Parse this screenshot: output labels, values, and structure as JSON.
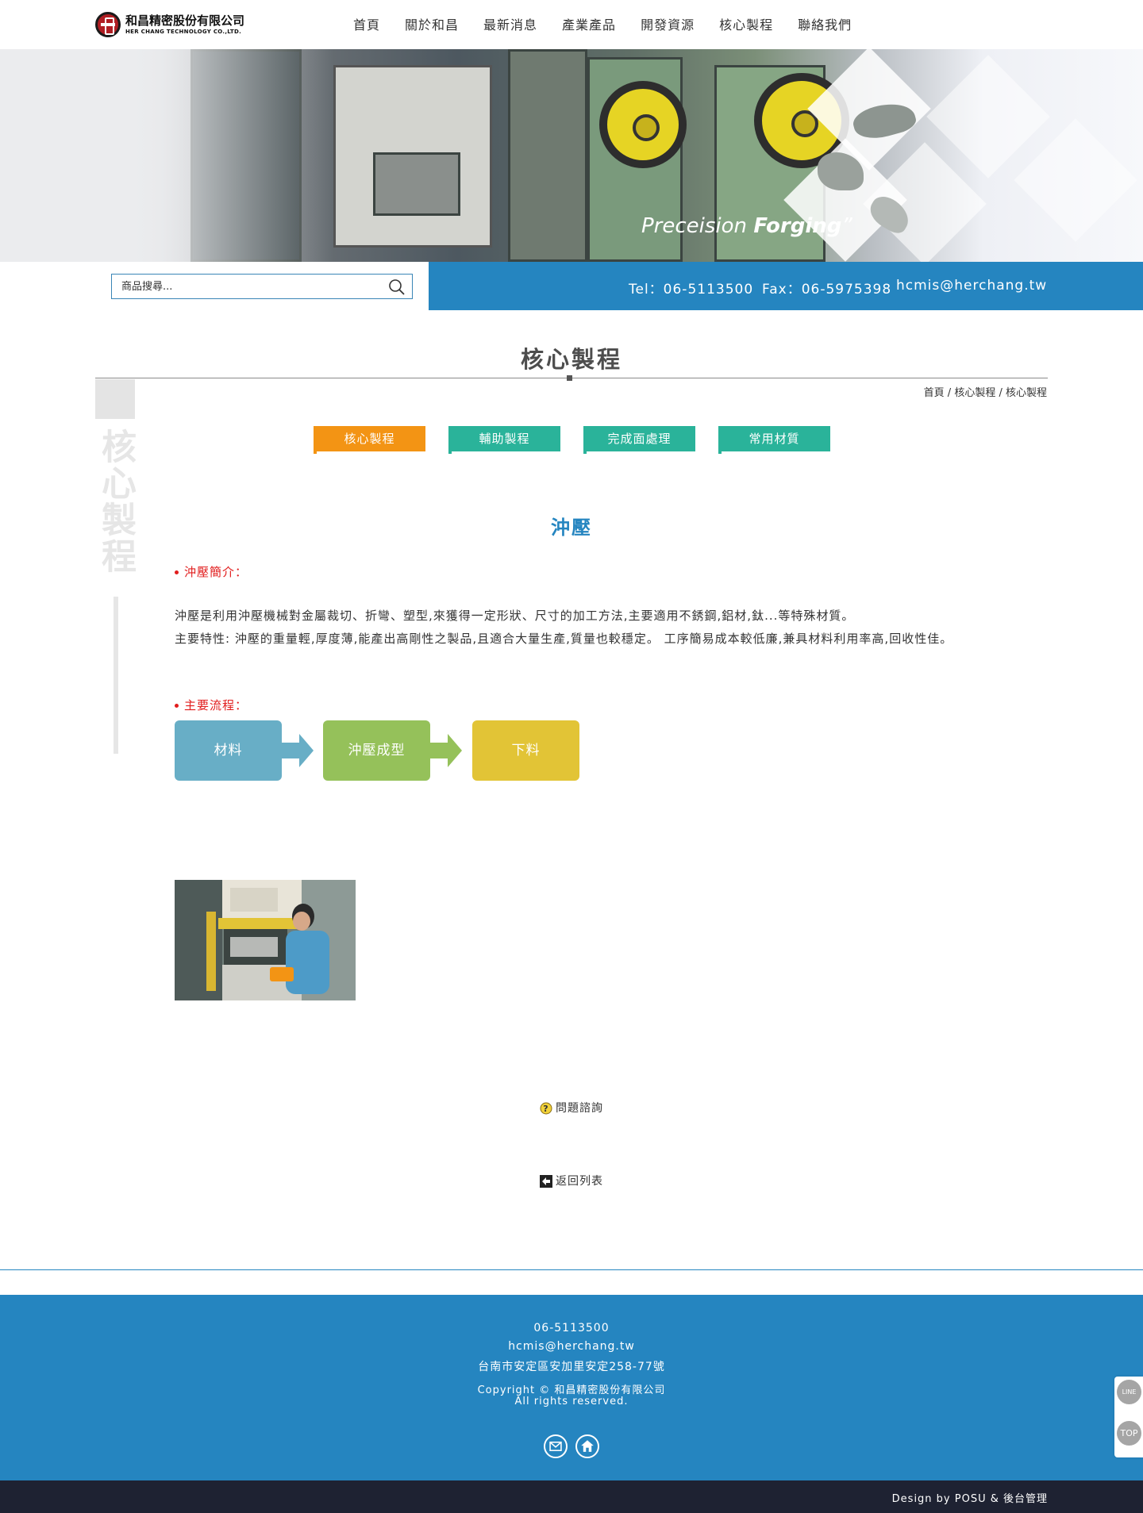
{
  "brand": {
    "name_cn": "和昌精密股份有限公司",
    "name_en": "HER CHANG TECHNOLOGY CO.,LTD."
  },
  "nav": {
    "items": [
      {
        "label": "首頁"
      },
      {
        "label": "關於和昌"
      },
      {
        "label": "最新消息"
      },
      {
        "label": "產業產品"
      },
      {
        "label": "開發資源"
      },
      {
        "label": "核心製程"
      },
      {
        "label": "聯絡我們"
      }
    ]
  },
  "banner": {
    "slogan_light": "Preceision ",
    "slogan_bold": "Forging",
    "slogan_mark": "”"
  },
  "search": {
    "placeholder": "商品搜尋..."
  },
  "contact": {
    "tel": "Tel：06-5113500",
    "fax": "Fax：06-5975398",
    "email": "hcmis@herchang.tw"
  },
  "page": {
    "title": "核心製程",
    "side_text": "核心製程"
  },
  "breadcrumb": {
    "home": "首頁",
    "sep": " / ",
    "level1": "核心製程",
    "level2": "核心製程"
  },
  "tabs": [
    {
      "label": "核心製程",
      "active": true
    },
    {
      "label": "輔助製程",
      "active": false
    },
    {
      "label": "完成面處理",
      "active": false
    },
    {
      "label": "常用材質",
      "active": false
    }
  ],
  "content": {
    "section_title": "沖壓",
    "intro_label": "沖壓簡介：",
    "intro_p1": "沖壓是利用沖壓機械對金屬裁切、折彎、塑型,來獲得一定形狀、尺寸的加工方法,主要適用不銹鋼,鋁材,鈦...等特殊材質。",
    "intro_p2": "主要特性: 沖壓的重量輕,厚度薄,能產出高剛性之製品,且適合大量生產,質量也較穩定。 工序簡易成本較低廉,兼具材料利用率高,回收性佳。",
    "flow_label": "主要流程：",
    "flow": [
      {
        "label": "材料",
        "color": "#68aec6"
      },
      {
        "label": "沖壓成型",
        "color": "#95c15a"
      },
      {
        "label": "下料",
        "color": "#e2c436"
      }
    ],
    "inquiry": "問題諮詢",
    "back": "返回列表"
  },
  "footer": {
    "phone": "06-5113500",
    "email": "hcmis@herchang.tw",
    "address": "台南市安定區安加里安定258-77號",
    "copyright": "Copyright © 和昌精密股份有限公司",
    "rights": "All rights reserved.",
    "credit": "Design by POSU & 後台管理"
  },
  "float": {
    "line": "LINE",
    "top": "TOP"
  },
  "colors": {
    "primary": "#2585c0",
    "tab_active": "#f39414",
    "tab_normal": "#2ab39a",
    "accent_red": "#e11d1d",
    "bottom_bar": "#1e2232"
  }
}
